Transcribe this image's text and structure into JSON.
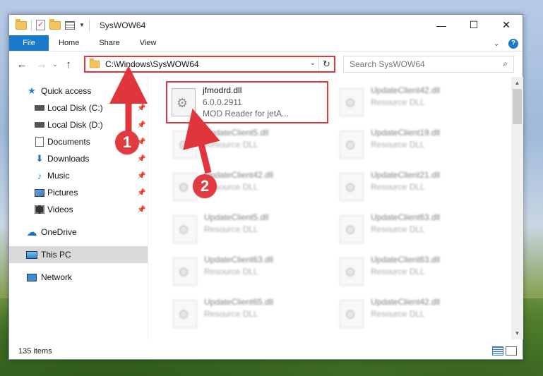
{
  "window": {
    "title": "SysWOW64",
    "controls": {
      "minimize": "—",
      "maximize": "☐",
      "close": "✕"
    }
  },
  "ribbon": {
    "tabs": [
      "File",
      "Home",
      "Share",
      "View"
    ],
    "expand": "⌄",
    "help": "?"
  },
  "nav": {
    "back": "←",
    "forward": "→",
    "recent": "⌄",
    "up": "↑",
    "address": "C:\\Windows\\SysWOW64",
    "address_dropdown": "⌄",
    "refresh": "↻",
    "search_placeholder": "Search SysWOW64",
    "search_icon": "⌕"
  },
  "sidebar": {
    "items": [
      {
        "label": "Quick access",
        "icon": "star-icon"
      },
      {
        "label": "Local Disk (C:)",
        "icon": "drive-icon"
      },
      {
        "label": "Local Disk (D:)",
        "icon": "drive-icon"
      },
      {
        "label": "Documents",
        "icon": "documents-icon"
      },
      {
        "label": "Downloads",
        "icon": "downloads-icon"
      },
      {
        "label": "Music",
        "icon": "music-icon"
      },
      {
        "label": "Pictures",
        "icon": "pictures-icon"
      },
      {
        "label": "Videos",
        "icon": "videos-icon"
      },
      {
        "label": "OneDrive",
        "icon": "cloud-icon"
      },
      {
        "label": "This PC",
        "icon": "pc-icon"
      },
      {
        "label": "Network",
        "icon": "network-icon"
      }
    ]
  },
  "files": [
    {
      "name": "jfmodrd.dll",
      "version": "6.0.0.2911",
      "desc": "MOD Reader for jetA..."
    },
    {
      "name": "UpdateClient42.dll",
      "desc": "Resource DLL"
    },
    {
      "name": "UpdateClient5.dll",
      "desc": "Resource DLL"
    },
    {
      "name": "UpdateClient19.dll",
      "desc": "Resource DLL"
    },
    {
      "name": "UpdateClient42.dll",
      "desc": "Resource DLL"
    },
    {
      "name": "UpdateClient21.dll",
      "desc": "Resource DLL"
    },
    {
      "name": "UpdateClient5.dll",
      "desc": "Resource DLL"
    },
    {
      "name": "UpdateClient63.dll",
      "desc": "Resource DLL"
    },
    {
      "name": "UpdateClient63.dll",
      "desc": "Resource DLL"
    },
    {
      "name": "UpdateClient63.dll",
      "desc": "Resource DLL"
    },
    {
      "name": "UpdateClient65.dll",
      "desc": "Resource DLL"
    },
    {
      "name": "UpdateClient42.dll",
      "desc": "Resource DLL"
    }
  ],
  "status": {
    "count": "135 items"
  },
  "annotations": {
    "step1": "1",
    "step2": "2"
  },
  "colors": {
    "accent": "#1979ca",
    "annotation_red": "#e0353b"
  }
}
